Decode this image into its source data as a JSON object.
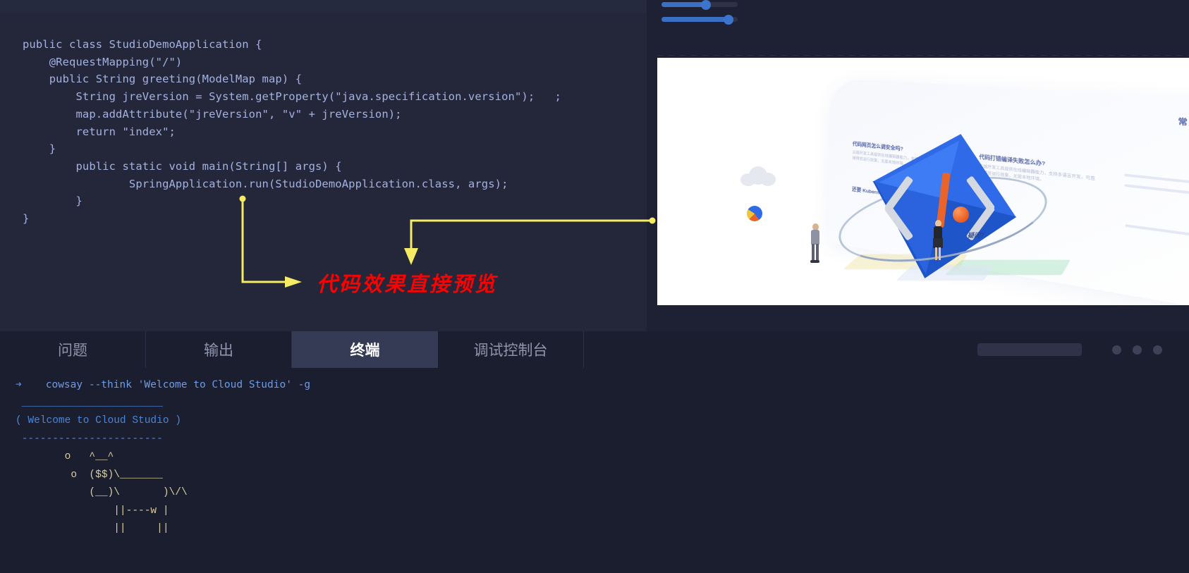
{
  "editor": {
    "code": "public class StudioDemoApplication {\n    @RequestMapping(\"/\")\n    public String greeting(ModelMap map) {\n        String jreVersion = System.getProperty(\"java.specification.version\");   ;\n        map.addAttribute(\"jreVersion\", \"v\" + jreVersion);\n        return \"index\";\n    }\n        public static void main(String[] args) {\n                SpringApplication.run(StudioDemoApplication.class, args);\n        }\n}"
  },
  "annotation": {
    "note": "代码效果直接预览",
    "color": "#ff0000",
    "line_color": "#f5ec63"
  },
  "preview": {
    "sliders": [
      {
        "name": "slider-1",
        "fill_percent": 62
      },
      {
        "name": "slider-2",
        "fill_percent": 87
      }
    ],
    "illustration": {
      "faq_title": "常见问题",
      "questions": [
        "代码网页怎么调安全吗?",
        "代码打错编译失败怎么办?",
        "还要 Kubernetes 环境吗?"
      ],
      "body_text": "云端开发工具提供在线编辑器能力，支持多语言开发，可直接预览运行效果，无需本地环境。",
      "bubble": "疑问?",
      "accent_blue": "#2f6ae8",
      "accent_orange": "#e8561c"
    }
  },
  "panel": {
    "tabs": [
      {
        "label": "问题",
        "active": false
      },
      {
        "label": "输出",
        "active": false
      },
      {
        "label": "终端",
        "active": true
      },
      {
        "label": "调试控制台",
        "active": false
      }
    ]
  },
  "terminal": {
    "prompt_symbol": "➜",
    "command": "cowsay --think 'Welcome to Cloud Studio' -g",
    "output_bubble": " _______________________\n( Welcome to Cloud Studio )\n -----------------------",
    "output_cow": "        o   ^__^\n         o  ($$)\\_______\n            (__)\\       )\\/\\\n                ||----w |\n                ||     ||"
  }
}
